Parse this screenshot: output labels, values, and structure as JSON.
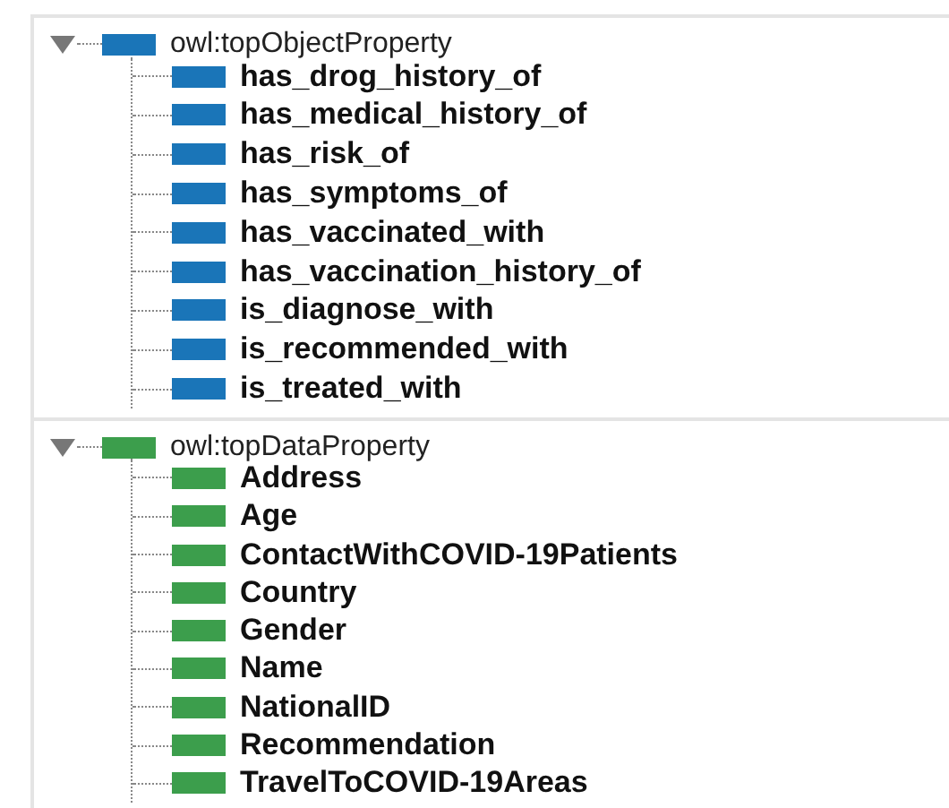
{
  "trees": [
    {
      "kind": "object",
      "root": {
        "label": "owl:topObjectProperty",
        "expanded": true,
        "children": [
          {
            "label": "has_drog_history_of"
          },
          {
            "label": "has_medical_history_of"
          },
          {
            "label": "has_risk_of"
          },
          {
            "label": "has_symptoms_of"
          },
          {
            "label": "has_vaccinated_with"
          },
          {
            "label": "has_vaccination_history_of"
          },
          {
            "label": "is_diagnose_with"
          },
          {
            "label": "is_recommended_with"
          },
          {
            "label": "is_treated_with"
          }
        ]
      }
    },
    {
      "kind": "data",
      "root": {
        "label": "owl:topDataProperty",
        "expanded": true,
        "children": [
          {
            "label": "Address"
          },
          {
            "label": "Age"
          },
          {
            "label": "ContactWithCOVID-19Patients"
          },
          {
            "label": "Country"
          },
          {
            "label": "Gender"
          },
          {
            "label": "Name"
          },
          {
            "label": "NationalID"
          },
          {
            "label": "Recommendation"
          },
          {
            "label": "TravelToCOVID-19Areas"
          }
        ]
      }
    }
  ]
}
